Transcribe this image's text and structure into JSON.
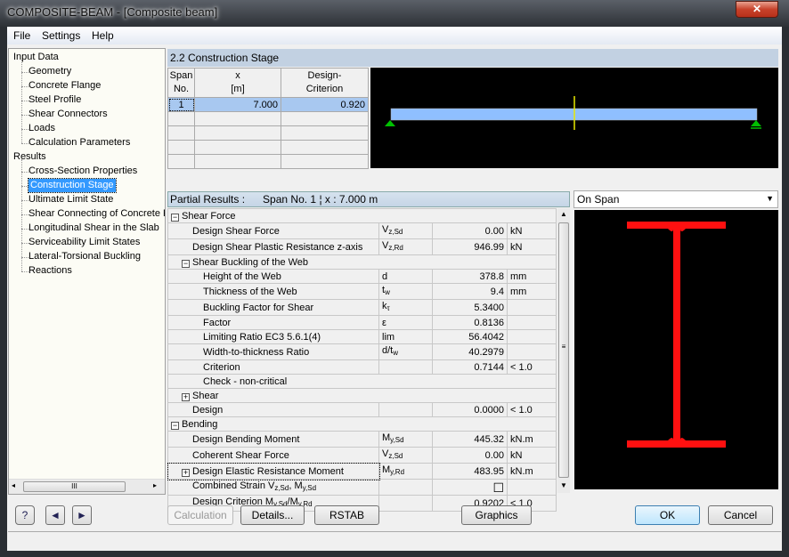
{
  "window": {
    "title": "COMPOSITE-BEAM - [Composite beam]",
    "close": "✕"
  },
  "menu": [
    "File",
    "Settings",
    "Help"
  ],
  "tree": [
    {
      "label": "Input Data",
      "level": 0
    },
    {
      "label": "Geometry",
      "level": 1
    },
    {
      "label": "Concrete Flange",
      "level": 1
    },
    {
      "label": "Steel Profile",
      "level": 1
    },
    {
      "label": "Shear Connectors",
      "level": 1
    },
    {
      "label": "Loads",
      "level": 1
    },
    {
      "label": "Calculation Parameters",
      "level": 1
    },
    {
      "label": "Results",
      "level": 0
    },
    {
      "label": "Cross-Section Properties",
      "level": 1
    },
    {
      "label": "Construction Stage",
      "level": 1,
      "selected": true
    },
    {
      "label": "Ultimate Limit State",
      "level": 1
    },
    {
      "label": "Shear Connecting of Concrete Flange",
      "level": 1
    },
    {
      "label": "Longitudinal Shear in the Slab",
      "level": 1
    },
    {
      "label": "Serviceability Limit States",
      "level": 1
    },
    {
      "label": "Lateral-Torsional Buckling",
      "level": 1
    },
    {
      "label": "Reactions",
      "level": 1
    }
  ],
  "hscroll_grip": "III",
  "section_title": "2.2 Construction Stage",
  "span_table": {
    "headers": [
      [
        "Span",
        "No."
      ],
      [
        "x",
        "[m]"
      ],
      [
        "Design-",
        "Criterion"
      ]
    ],
    "rows": [
      [
        "1",
        "7.000",
        "0.920"
      ]
    ],
    "empty_rows": 4
  },
  "beam": {
    "color": "#8fbfff",
    "marker_color": "#e8e800",
    "support_color": "#00c000"
  },
  "partial_results": {
    "label": "Partial Results :",
    "span": "Span No. 1",
    "sep": "¦",
    "x": "x : 7.000 m"
  },
  "view_dropdown": {
    "value": "On Span"
  },
  "section": {
    "color": "#ff1010"
  },
  "results": [
    {
      "lvl": 0,
      "exp": "-",
      "name": [
        [
          "Shear Force",
          ""
        ]
      ],
      "group": true
    },
    {
      "lvl": 1,
      "name": [
        [
          "Design Shear Force",
          ""
        ]
      ],
      "sym": [
        "V",
        "z,Sd"
      ],
      "val": "0.00",
      "unit": "kN"
    },
    {
      "lvl": 1,
      "name": [
        [
          "Design Shear Plastic Resistance z-axis",
          ""
        ]
      ],
      "sym": [
        "V",
        "z,Rd"
      ],
      "val": "946.99",
      "unit": "kN"
    },
    {
      "lvl": 1,
      "exp": "-",
      "name": [
        [
          "Shear Buckling of the Web",
          ""
        ]
      ],
      "group": true
    },
    {
      "lvl": 2,
      "name": [
        [
          "Height of the Web",
          ""
        ]
      ],
      "sym": [
        "d",
        ""
      ],
      "val": "378.8",
      "unit": "mm"
    },
    {
      "lvl": 2,
      "name": [
        [
          "Thickness of the Web",
          ""
        ]
      ],
      "sym": [
        "t",
        "w"
      ],
      "val": "9.4",
      "unit": "mm"
    },
    {
      "lvl": 2,
      "name": [
        [
          "Buckling Factor for Shear",
          ""
        ]
      ],
      "sym": [
        "k",
        "τ"
      ],
      "val": "5.3400",
      "unit": ""
    },
    {
      "lvl": 2,
      "name": [
        [
          "Factor",
          ""
        ]
      ],
      "sym": [
        "ε",
        ""
      ],
      "val": "0.8136",
      "unit": ""
    },
    {
      "lvl": 2,
      "name": [
        [
          "Limiting Ratio EC3 5.6.1(4)",
          ""
        ]
      ],
      "sym": [
        "lim",
        ""
      ],
      "val": "56.4042",
      "unit": ""
    },
    {
      "lvl": 2,
      "name": [
        [
          "Width-to-thickness Ratio",
          ""
        ]
      ],
      "sym": [
        "d/t",
        "w"
      ],
      "val": "40.2979",
      "unit": ""
    },
    {
      "lvl": 2,
      "name": [
        [
          "Criterion",
          ""
        ]
      ],
      "sym": [
        "",
        ""
      ],
      "val": "0.7144",
      "unit": "< 1.0"
    },
    {
      "lvl": 2,
      "name": [
        [
          "Check - non-critical",
          ""
        ]
      ],
      "group": true
    },
    {
      "lvl": 1,
      "exp": "+",
      "name": [
        [
          "Shear",
          ""
        ]
      ],
      "group": true
    },
    {
      "lvl": 1,
      "name": [
        [
          "Design",
          ""
        ]
      ],
      "sym": [
        "",
        ""
      ],
      "val": "0.0000",
      "unit": "< 1.0"
    },
    {
      "lvl": 0,
      "exp": "-",
      "name": [
        [
          "Bending",
          ""
        ]
      ],
      "group": true
    },
    {
      "lvl": 1,
      "name": [
        [
          "Design Bending Moment",
          ""
        ]
      ],
      "sym": [
        "M",
        "y,Sd"
      ],
      "val": "445.32",
      "unit": "kN.m"
    },
    {
      "lvl": 1,
      "name": [
        [
          "Coherent Shear Force",
          ""
        ]
      ],
      "sym": [
        "V",
        "z,Sd"
      ],
      "val": "0.00",
      "unit": "kN"
    },
    {
      "lvl": 1,
      "exp": "+",
      "name": [
        [
          "Design Elastic Resistance Moment",
          ""
        ]
      ],
      "sym": [
        "M",
        "y,Rd"
      ],
      "val": "483.95",
      "unit": "kN.m",
      "focus": true
    },
    {
      "lvl": 1,
      "name": [
        [
          "Combined Strain V",
          "z,Sd"
        ],
        [
          ", M",
          "y,Sd"
        ]
      ],
      "sym": [
        "",
        ""
      ],
      "val": "☐",
      "unit": ""
    },
    {
      "lvl": 1,
      "name": [
        [
          "Design Criterion M",
          "y,Sd"
        ],
        [
          "/M",
          "y,Rd"
        ]
      ],
      "sym": [
        "",
        ""
      ],
      "val": "0.9202",
      "unit": "< 1.0"
    }
  ],
  "buttons": {
    "help": "?",
    "prev": "◄",
    "next": "►",
    "calculation": "Calculation",
    "details": "Details...",
    "rstab": "RSTAB",
    "graphics": "Graphics",
    "ok": "OK",
    "cancel": "Cancel"
  }
}
